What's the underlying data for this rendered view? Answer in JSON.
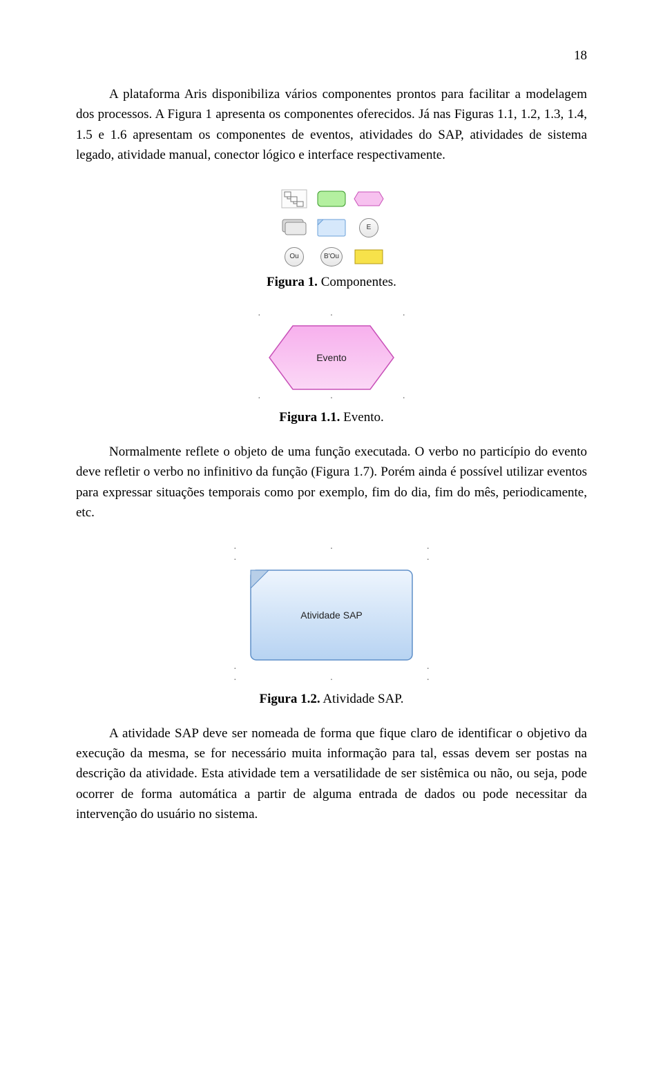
{
  "page_number": "18",
  "para1": "A plataforma Aris disponibiliza vários componentes prontos para facilitar a modelagem dos processos. A Figura 1 apresenta os componentes oferecidos. Já nas Figuras 1.1, 1.2, 1.3, 1.4, 1.5 e 1.6 apresentam os componentes de eventos, atividades do SAP, atividades de sistema legado, atividade manual, conector lógico e interface respectivamente.",
  "fig1": {
    "label": "Figura 1.",
    "title": " Componentes.",
    "palette_icons": {
      "row2_col3_text": "E",
      "row3_col1_text": "Ou",
      "row3_col2_text": "B'Ou"
    }
  },
  "fig2": {
    "label": "Figura 1.1.",
    "title": " Evento.",
    "shape_text": "Evento"
  },
  "para2": "Normalmente reflete o objeto de uma função executada. O verbo no particípio do evento deve refletir o verbo no infinitivo da função (Figura 1.7). Porém ainda é possível utilizar eventos para expressar situações temporais como por exemplo, fim do dia, fim do mês, periodicamente, etc.",
  "fig3": {
    "label": "Figura 1.2.",
    "title": " Atividade SAP.",
    "shape_text": "Atividade SAP"
  },
  "para3": "A atividade SAP deve ser nomeada de forma que fique claro de identificar o objetivo da execução da mesma, se for necessário muita informação para tal, essas devem ser postas na descrição da atividade. Esta atividade tem a versatilidade de ser sistêmica ou não, ou seja, pode ocorrer de forma automática a partir de alguma entrada de dados ou pode necessitar da intervenção do usuário no sistema."
}
